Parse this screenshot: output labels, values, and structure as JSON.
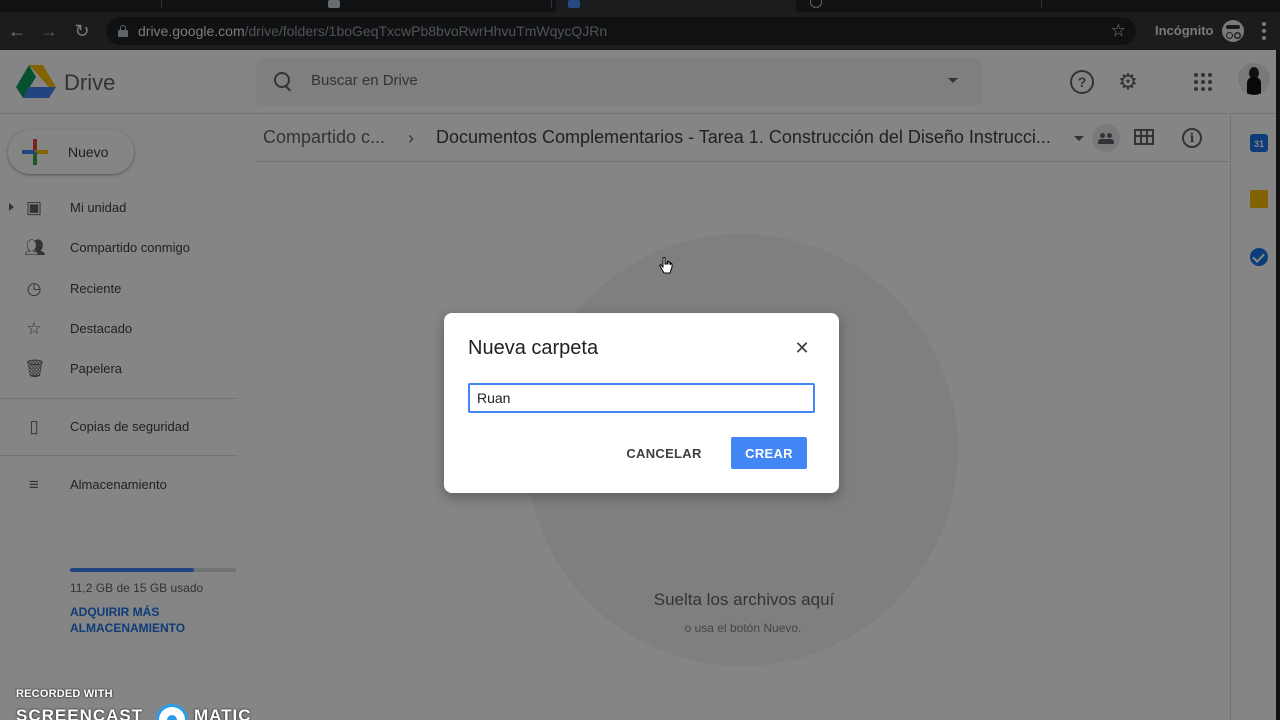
{
  "colors": {
    "accent": "#4285f4",
    "link": "#1a73e8",
    "browser_toolbar": "#35363a",
    "overlay": "rgba(0,0,0,0.48)"
  },
  "browser": {
    "url_host": "drive.google.com",
    "url_path": "/drive/folders/1boGeqTxcwPb8bvoRwrHhvuTmWqycQJRn",
    "incognito_label": "Incógnito"
  },
  "header": {
    "app_title": "Drive",
    "search_placeholder": "Buscar en Drive"
  },
  "sidebar": {
    "new_label": "Nuevo",
    "items": [
      {
        "label": "Mi unidad",
        "icon": "drive-icon"
      },
      {
        "label": "Compartido conmigo",
        "icon": "people-icon"
      },
      {
        "label": "Reciente",
        "icon": "clock-icon"
      },
      {
        "label": "Destacado",
        "icon": "star-icon"
      },
      {
        "label": "Papelera",
        "icon": "trash-icon"
      }
    ],
    "backups": {
      "label": "Copias de seguridad",
      "icon": "backup-icon"
    },
    "storage": {
      "label": "Almacenamiento",
      "icon": "storage-icon",
      "usage_text": "11,2 GB de 15 GB usado",
      "used_fraction": 0.747,
      "buy_more": "ADQUIRIR MÁS ALMACENAMIENTO"
    }
  },
  "breadcrumb": {
    "parent": "Compartido c...",
    "separator": "›",
    "current": "Documentos Complementarios - Tarea 1. Construcción del Diseño Instrucci..."
  },
  "dropzone": {
    "title": "Suelta los archivos aquí",
    "subtitle": "o usa el botón Nuevo."
  },
  "right_rail": {
    "calendar_day": "31"
  },
  "dialog": {
    "title": "Nueva carpeta",
    "input_value": "Ruan",
    "cancel_label": "CANCELAR",
    "create_label": "CREAR"
  },
  "watermark": {
    "line1": "RECORDED WITH",
    "brand_left": "SCREENCAST",
    "brand_right": "MATIC"
  }
}
